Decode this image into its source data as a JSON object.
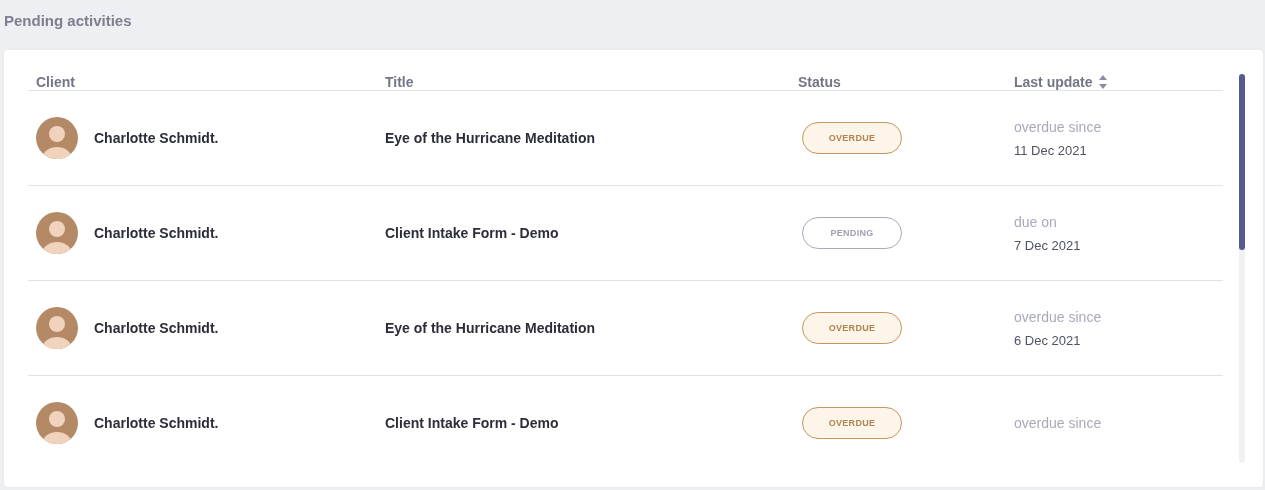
{
  "heading": "Pending activities",
  "columns": [
    {
      "label": "Client",
      "sortable": false
    },
    {
      "label": "Title",
      "sortable": false
    },
    {
      "label": "Status",
      "sortable": false
    },
    {
      "label": "Last update",
      "sortable": true
    }
  ],
  "rows": [
    {
      "client": "Charlotte Schmidt.",
      "title": "Eye of the Hurricane Meditation",
      "status": {
        "label": "OVERDUE",
        "kind": "overdue"
      },
      "update_label": "overdue since",
      "update_date": "11 Dec 2021"
    },
    {
      "client": "Charlotte Schmidt.",
      "title": "Client Intake Form - Demo",
      "status": {
        "label": "PENDING",
        "kind": "pending"
      },
      "update_label": "due on",
      "update_date": "7 Dec 2021"
    },
    {
      "client": "Charlotte Schmidt.",
      "title": "Eye of the Hurricane Meditation",
      "status": {
        "label": "OVERDUE",
        "kind": "overdue"
      },
      "update_label": "overdue since",
      "update_date": "6 Dec 2021"
    },
    {
      "client": "Charlotte Schmidt.",
      "title": "Client Intake Form - Demo",
      "status": {
        "label": "OVERDUE",
        "kind": "overdue"
      },
      "update_label": "overdue since"
    }
  ]
}
